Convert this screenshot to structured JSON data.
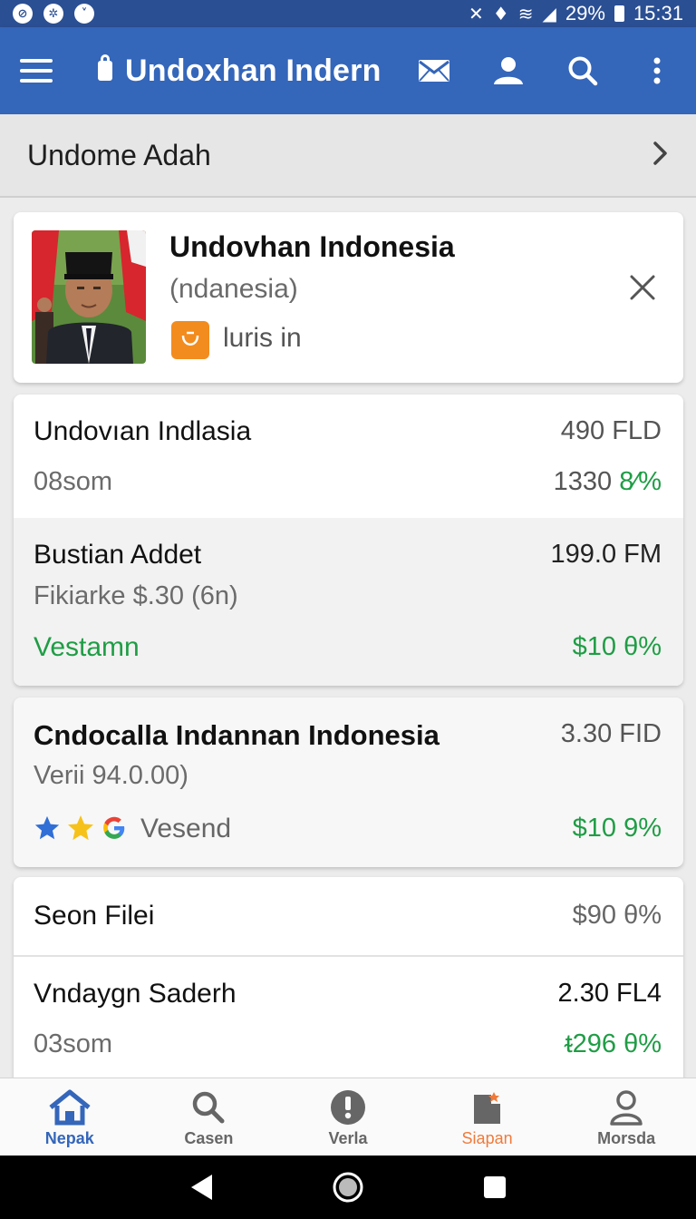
{
  "status_bar": {
    "battery": "29%",
    "time": "15:31",
    "left_icons": [
      "check-circle-icon",
      "settings-circle-icon",
      "down-circle-icon"
    ]
  },
  "app_bar": {
    "title": "Undoxhan Indern",
    "actions": [
      "mail-icon",
      "person-icon",
      "search-icon",
      "more-vert-icon"
    ]
  },
  "breadcrumb": {
    "label": "Undome Adah"
  },
  "profile": {
    "name": "Undovhan Indonesia",
    "subtitle": "(ndanesia)",
    "badge_label": "luris in"
  },
  "card_primary": {
    "title": "Undovıan Indlasia",
    "title_value": "490 FLD",
    "sub": "08som",
    "sub_value_num": "1330",
    "sub_value_pct": "8⁄%"
  },
  "card_primary_b": {
    "title": "Bustian Addet",
    "title_value": "199.0 FM",
    "sub": "Fikiarke $.30 (6n)",
    "status": "Vestamn",
    "status_value": "$10 θ%"
  },
  "card_third": {
    "title": "Cndocalla Indannan Indonesia",
    "title_value": "3.30 FID",
    "sub": "Verii 94.0.00)",
    "label": "Vesend",
    "value": "$10 9%"
  },
  "card_fourth": {
    "row1_title": "Seon Filei",
    "row1_value": "$90 θ%",
    "row2_title": "Vndaygn Saderh",
    "row2_value": "2.30 FL4",
    "row2_sub": "03som",
    "row2_sub_value": "ᵵ296 θ%"
  },
  "bottom_nav": [
    {
      "label": "Nepak",
      "icon": "home-icon"
    },
    {
      "label": "Casen",
      "icon": "search-icon"
    },
    {
      "label": "Verla",
      "icon": "info-icon"
    },
    {
      "label": "Siapan",
      "icon": "document-icon"
    },
    {
      "label": "Morsda",
      "icon": "person-icon"
    }
  ],
  "colors": {
    "app_bar": "#3466ba",
    "status_bar": "#2b4f93",
    "positive": "#1f9d45",
    "accent_orange": "#f28c1e"
  }
}
